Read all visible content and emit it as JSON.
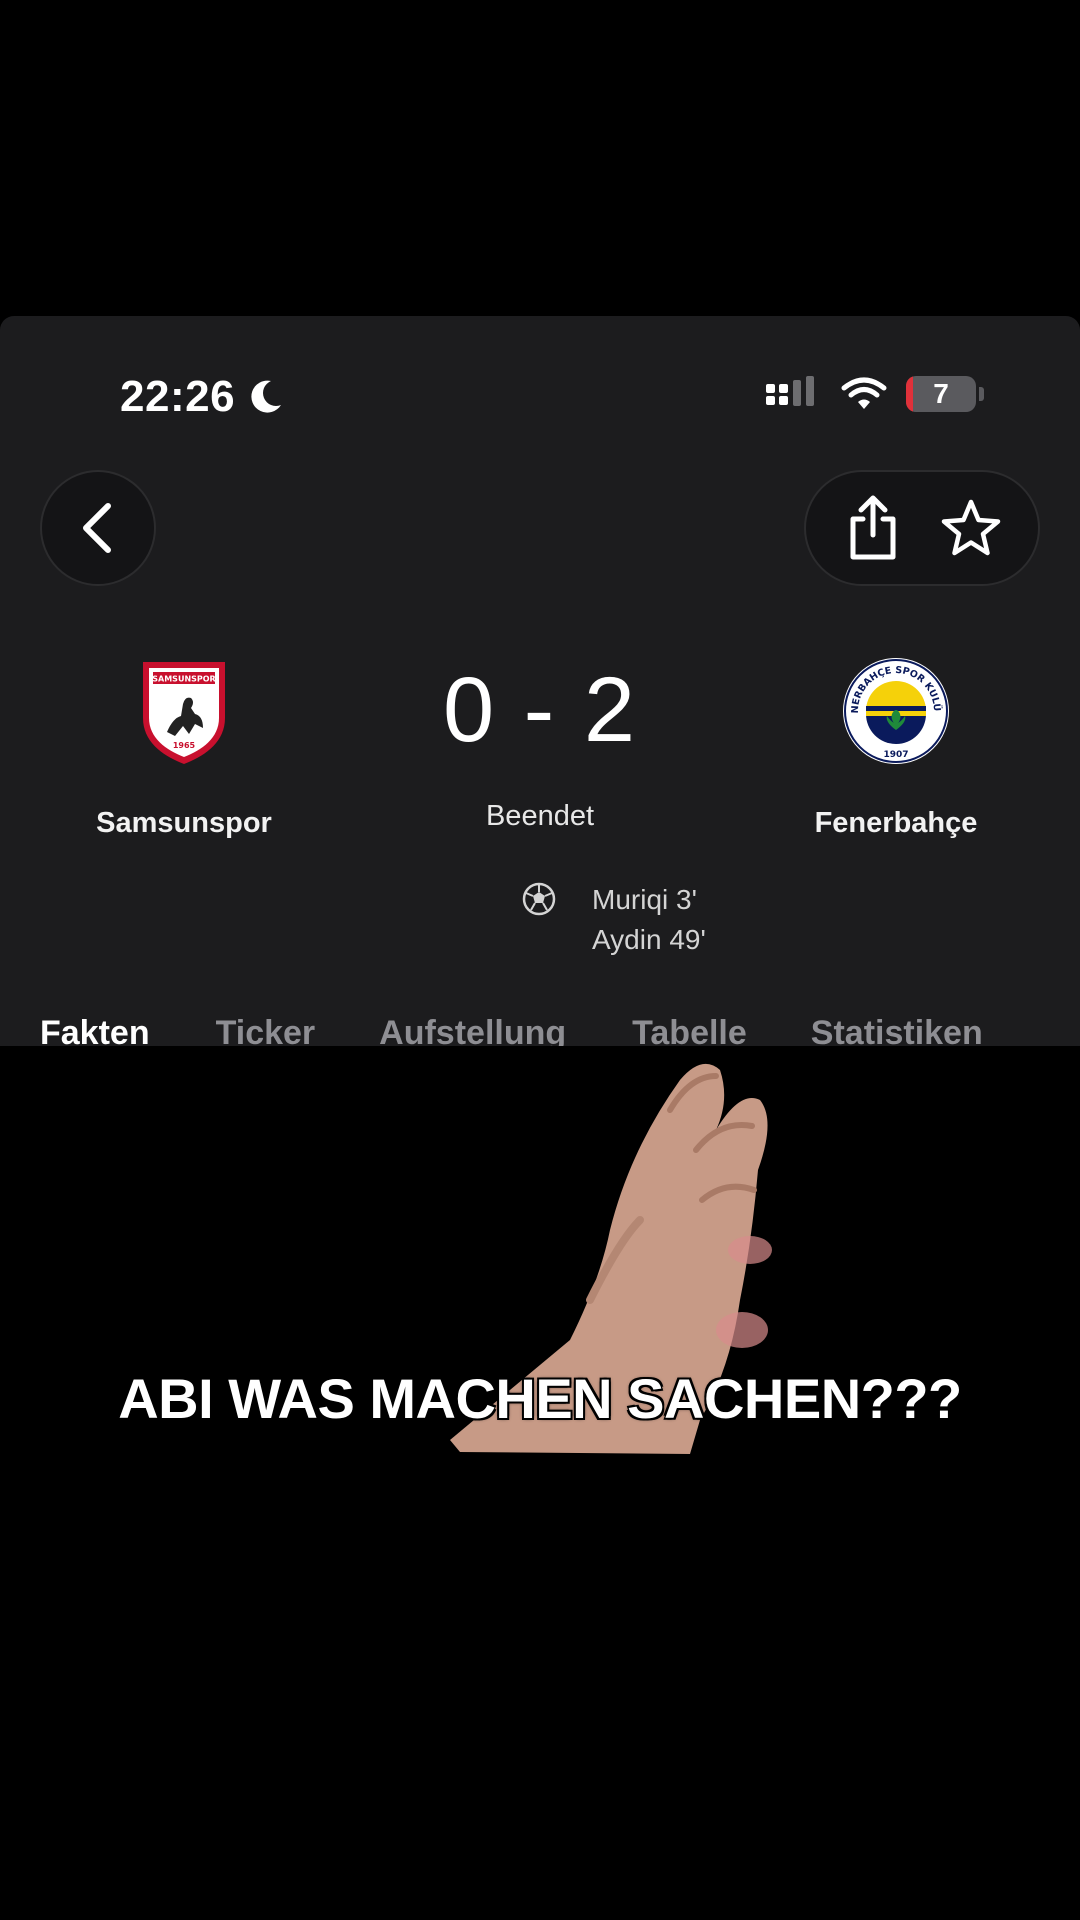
{
  "status_bar": {
    "time": "22:26",
    "battery": "7"
  },
  "match": {
    "home_team": "Samsunspor",
    "away_team": "Fenerbahçe",
    "score": "0 - 2",
    "status": "Beendet",
    "goals": [
      "Muriqi 3'",
      "Aydin 49'"
    ],
    "home_crest_text": "SAMSUNSPOR",
    "home_crest_year": "1965",
    "away_crest_text": "FENERBAHÇE SPOR KULÜBÜ",
    "away_crest_year": "1907"
  },
  "tabs": [
    {
      "label": "Fakten",
      "active": true
    },
    {
      "label": "Ticker",
      "active": false
    },
    {
      "label": "Aufstellung",
      "active": false
    },
    {
      "label": "Tabelle",
      "active": false
    },
    {
      "label": "Statistiken",
      "active": false
    }
  ],
  "overlay": {
    "caption": "ABI WAS MACHEN SACHEN???"
  },
  "icons": {
    "back": "chevron-left-icon",
    "share": "share-icon",
    "favorite": "star-icon",
    "goal": "soccer-ball-icon"
  },
  "colors": {
    "background": "#000000",
    "panel": "#1c1c1e",
    "battery_low": "#e0313a",
    "samsunspor_red": "#c8102e",
    "fener_yellow": "#f5d10a",
    "fener_navy": "#0a1a5c"
  }
}
